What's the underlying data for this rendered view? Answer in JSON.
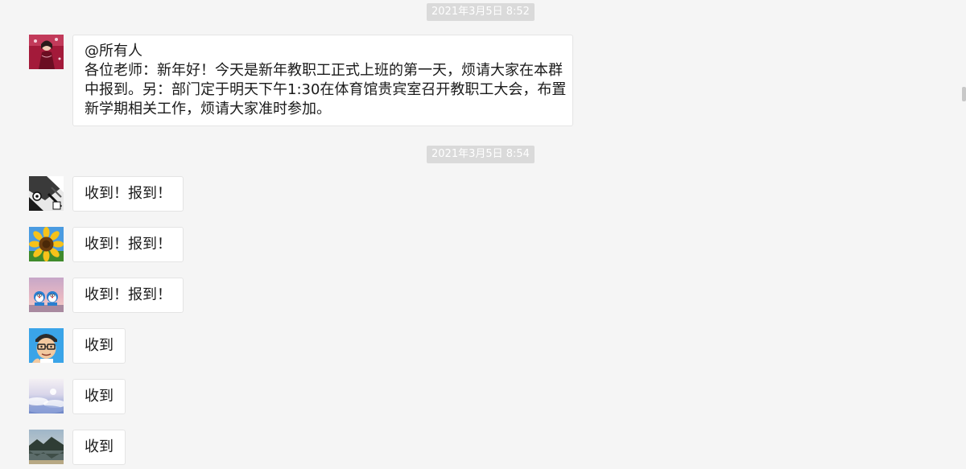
{
  "timestamps": [
    "2021年3月5日 8:52",
    "2021年3月5日 8:54"
  ],
  "messages": [
    {
      "avatar": "woman-portrait-avatar",
      "lines": [
        "@所有人",
        "各位老师：新年好！今天是新年教职工正式上班的第一天，烦请大家在本群",
        "中报到。另：部门定于明天下午1:30在体育馆贵宾室召开教职工大会，布置",
        "新学期相关工作，烦请大家准时参加。"
      ]
    },
    {
      "avatar": "anime-sketch-avatar",
      "text": "收到！报到！"
    },
    {
      "avatar": "sunflower-avatar",
      "text": "收到！报到！"
    },
    {
      "avatar": "doraemon-avatar",
      "text": "收到！报到！"
    },
    {
      "avatar": "cartoon-man-avatar",
      "text": "收到"
    },
    {
      "avatar": "clouds-avatar",
      "text": "收到"
    },
    {
      "avatar": "mountain-lake-avatar",
      "text": "收到"
    }
  ],
  "colors": {
    "background": "#f5f5f5",
    "bubble": "#ffffff",
    "timestamp_bg": "#dadada",
    "timestamp_text": "#ffffff"
  }
}
